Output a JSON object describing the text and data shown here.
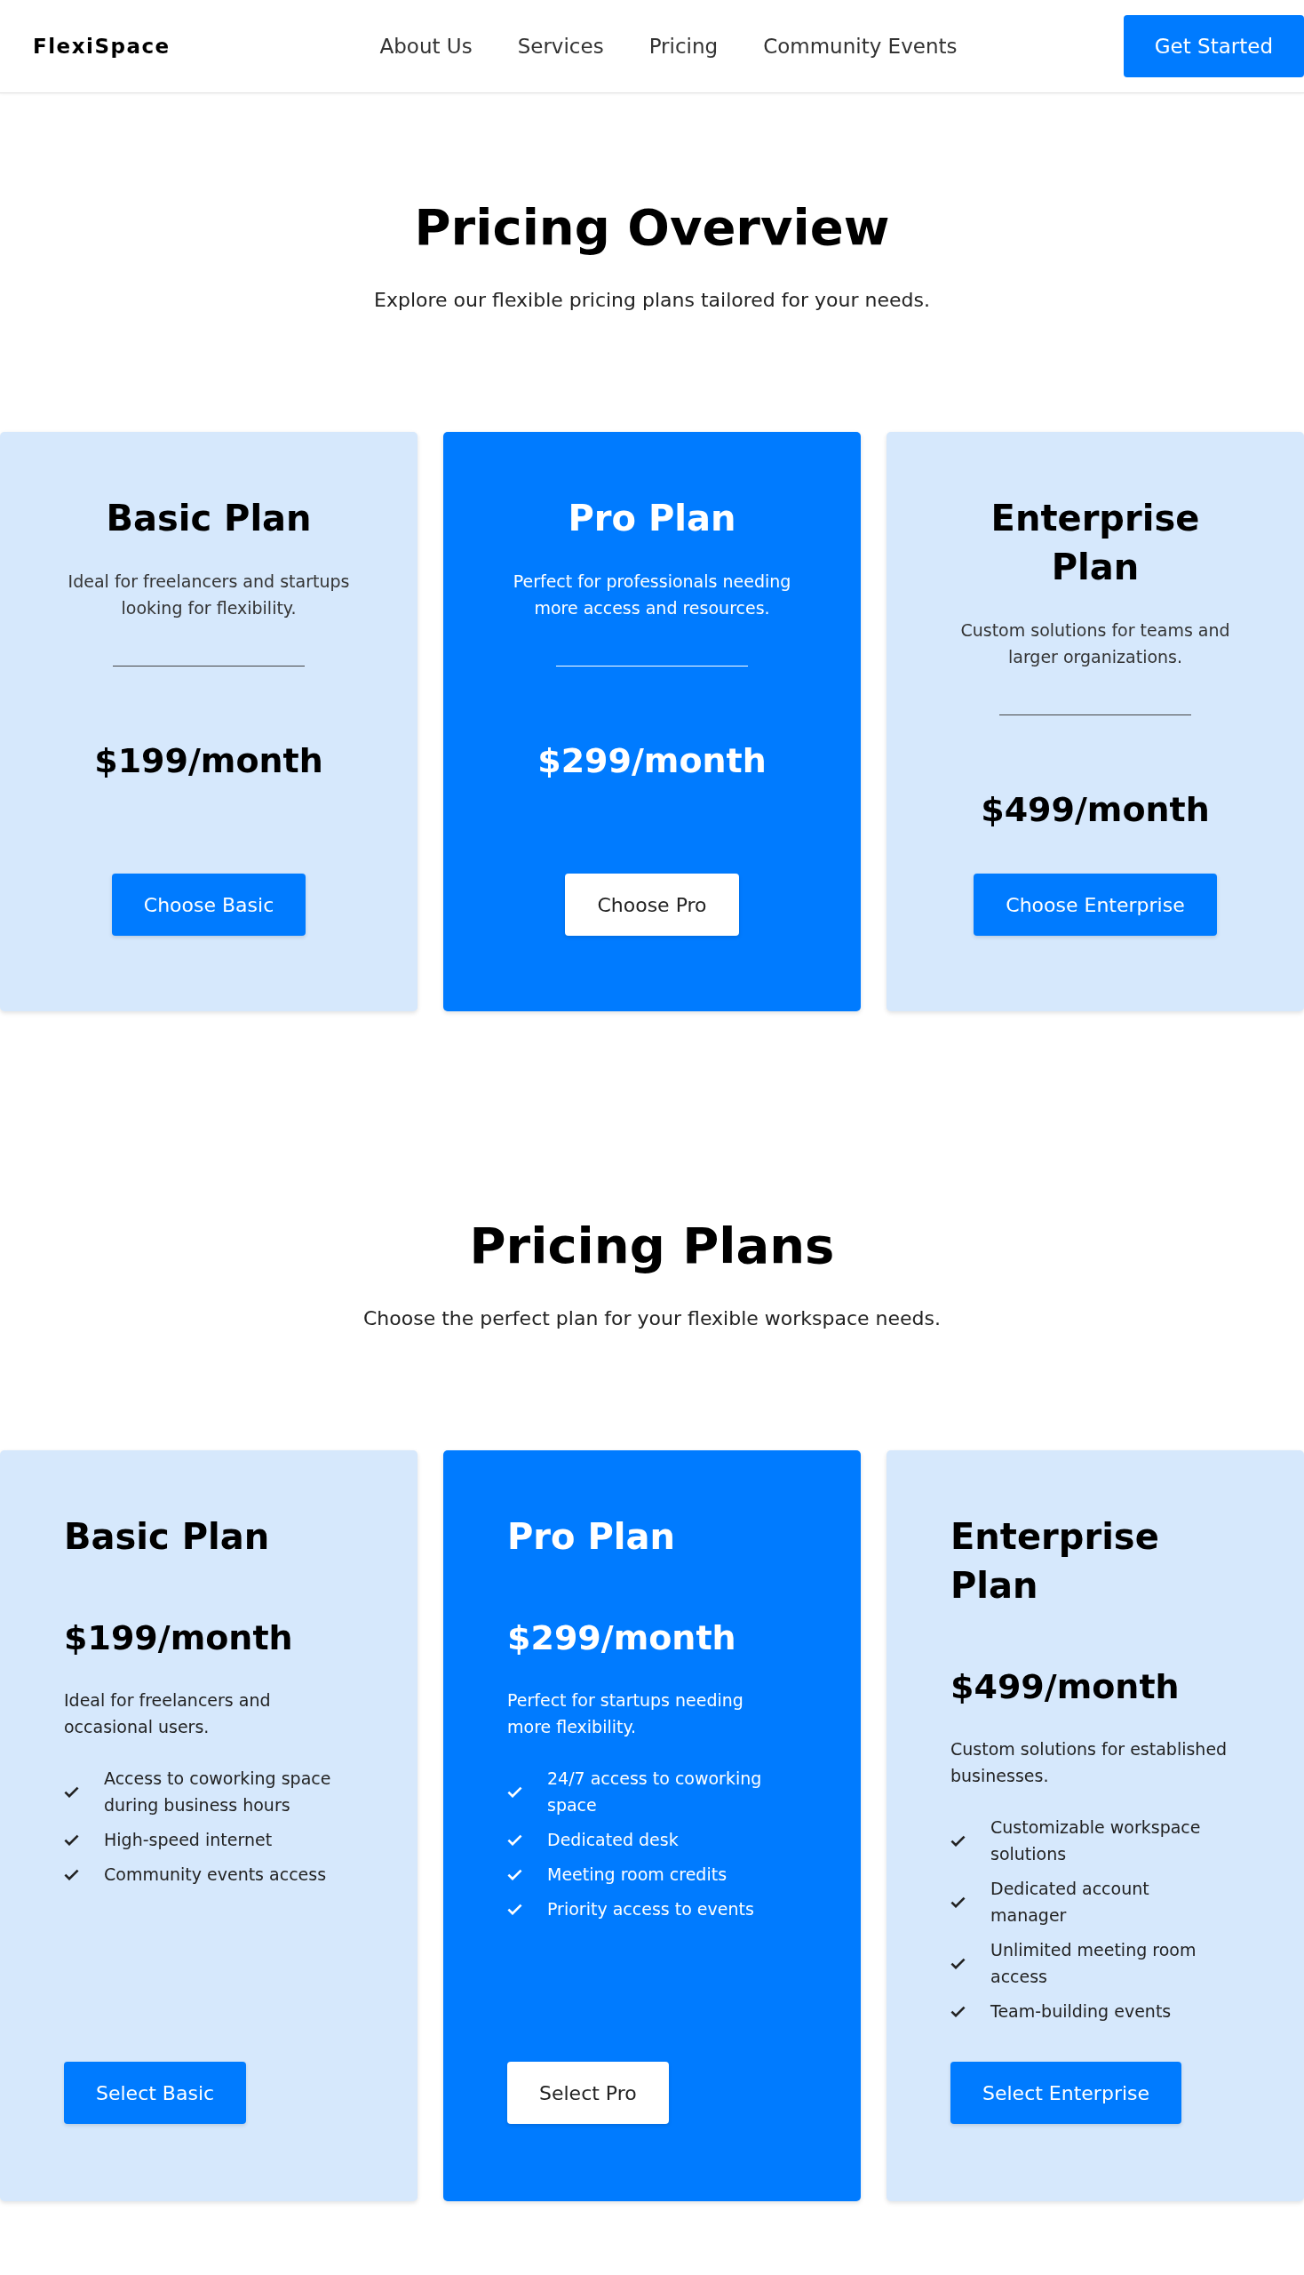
{
  "header": {
    "logo": "FlexiSpace",
    "nav": [
      "About Us",
      "Services",
      "Pricing",
      "Community Events"
    ],
    "button": "Get Started"
  },
  "overview": {
    "title": "Pricing Overview",
    "subtitle": "Explore our flexible pricing plans tailored for your needs.",
    "plans": [
      {
        "name": "Basic Plan",
        "description": "Ideal for freelancers and startups looking for flexibility.",
        "price": "$199/month",
        "button": "Choose Basic",
        "highlighted": false
      },
      {
        "name": "Pro Plan",
        "description": "Perfect for professionals needing more access and resources.",
        "price": "$299/month",
        "button": "Choose Pro",
        "highlighted": true
      },
      {
        "name": "Enterprise Plan",
        "description": "Custom solutions for teams and larger organizations.",
        "price": "$499/month",
        "button": "Choose Enterprise",
        "highlighted": false
      }
    ]
  },
  "plans": {
    "title": "Pricing Plans",
    "subtitle": "Choose the perfect plan for your flexible workspace needs.",
    "plans": [
      {
        "name": "Basic Plan",
        "price": "$199/month",
        "description": "Ideal for freelancers and occasional users.",
        "features": [
          "Access to coworking space during business hours",
          "High-speed internet",
          "Community events access"
        ],
        "button": "Select Basic",
        "highlighted": false
      },
      {
        "name": "Pro Plan",
        "price": "$299/month",
        "description": "Perfect for startups needing more flexibility.",
        "features": [
          "24/7 access to coworking space",
          "Dedicated desk",
          "Meeting room credits",
          "Priority access to events"
        ],
        "button": "Select Pro",
        "highlighted": true
      },
      {
        "name": "Enterprise Plan",
        "price": "$499/month",
        "description": "Custom solutions for established businesses.",
        "features": [
          "Customizable workspace solutions",
          "Dedicated account manager",
          "Unlimited meeting room access",
          "Team-building events"
        ],
        "button": "Select Enterprise",
        "highlighted": false
      }
    ]
  }
}
